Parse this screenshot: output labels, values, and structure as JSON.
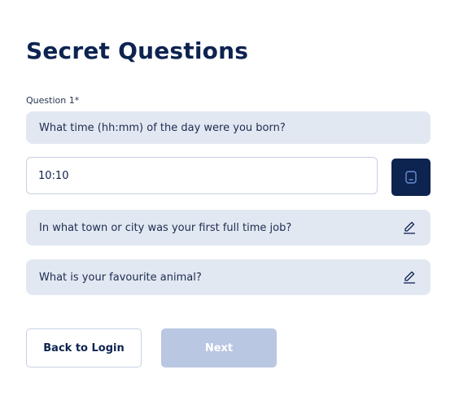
{
  "page": {
    "title": "Secret Questions"
  },
  "questions": {
    "q1_label": "Question 1*",
    "q1_text": "What time (hh:mm) of the day were you born?",
    "q1_answer": "10:10",
    "q2_text": "In what town or city was your first full time job?",
    "q3_text": "What is your favourite animal?"
  },
  "actions": {
    "back_label": "Back to Login",
    "next_label": "Next"
  },
  "icons": {
    "save": "save-icon",
    "edit": "pencil-edit-icon"
  },
  "colors": {
    "primary": "#0d2350",
    "pill_bg": "#e2e8f2",
    "disabled": "#b9c7e2"
  }
}
